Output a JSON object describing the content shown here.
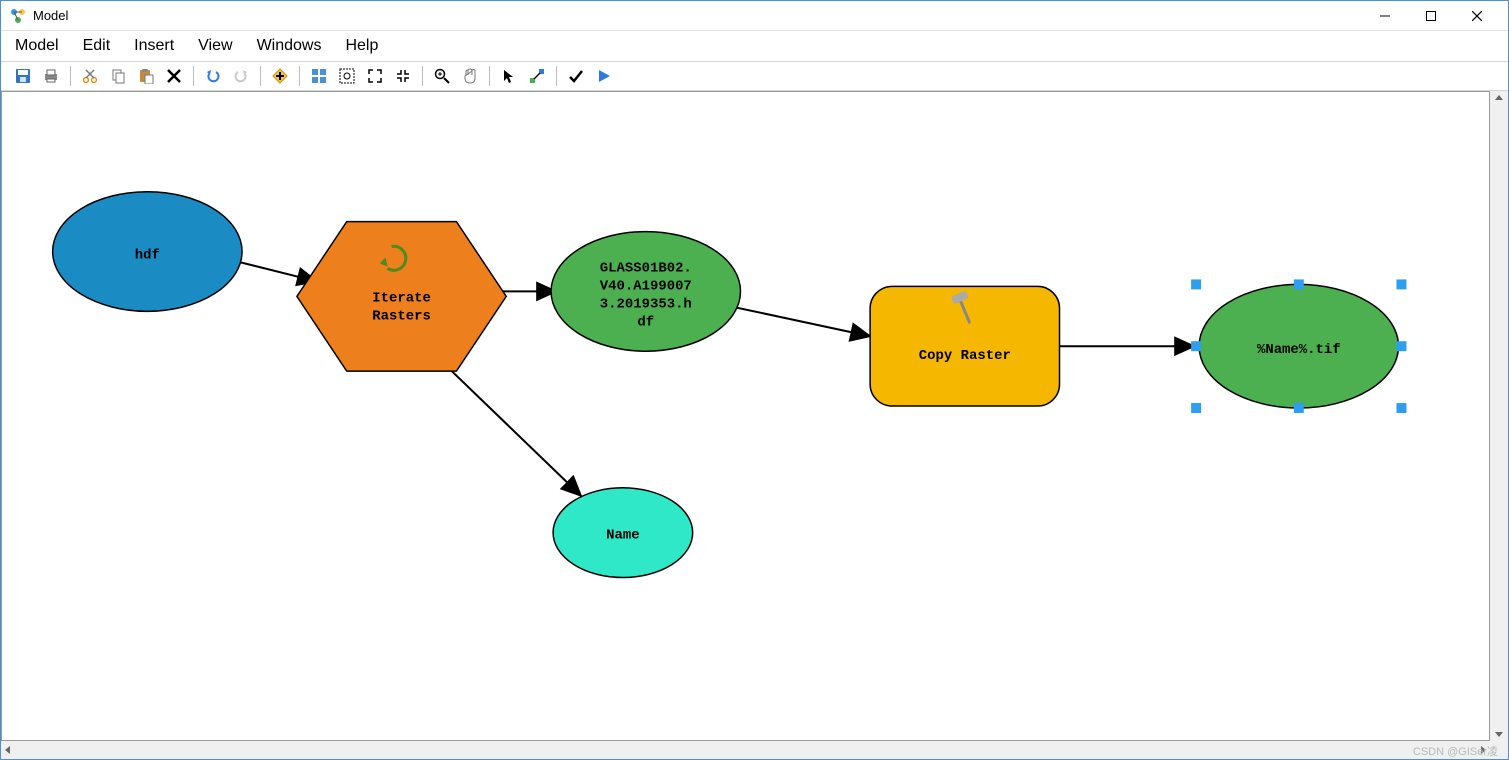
{
  "window": {
    "title": "Model"
  },
  "menu": {
    "items": [
      "Model",
      "Edit",
      "Insert",
      "View",
      "Windows",
      "Help"
    ]
  },
  "toolbar_icons": [
    "save-icon",
    "print-icon",
    "sep",
    "cut-icon",
    "copy-icon",
    "paste-icon",
    "delete-icon",
    "sep",
    "undo-icon",
    "redo-icon",
    "sep",
    "add-data-icon",
    "sep",
    "tiles-icon",
    "full-extent-icon",
    "zoom-in-rect-icon",
    "zoom-out-rect-icon",
    "sep",
    "magnify-icon",
    "pan-icon",
    "sep",
    "pointer-icon",
    "connect-icon",
    "sep",
    "validate-icon",
    "run-icon"
  ],
  "nodes": {
    "hdf": {
      "label": "hdf",
      "shape": "ellipse",
      "fill": "#1b8bc4"
    },
    "iterate": {
      "label1": "Iterate",
      "label2": "Rasters",
      "shape": "hexagon",
      "fill": "#ed801c"
    },
    "glass": {
      "lines": [
        "GLASS01B02.",
        "V40.A199007",
        "3.2019353.h",
        "df"
      ],
      "shape": "ellipse",
      "fill": "#4caf50"
    },
    "name": {
      "label": "Name",
      "shape": "ellipse",
      "fill": "#2fe8c8"
    },
    "copy": {
      "label": "Copy Raster",
      "shape": "roundrect",
      "fill": "#f5b700"
    },
    "output": {
      "label": "%Name%.tif",
      "shape": "ellipse",
      "fill": "#4caf50",
      "selected": true
    }
  },
  "watermark": "CSDN @GISer凌"
}
